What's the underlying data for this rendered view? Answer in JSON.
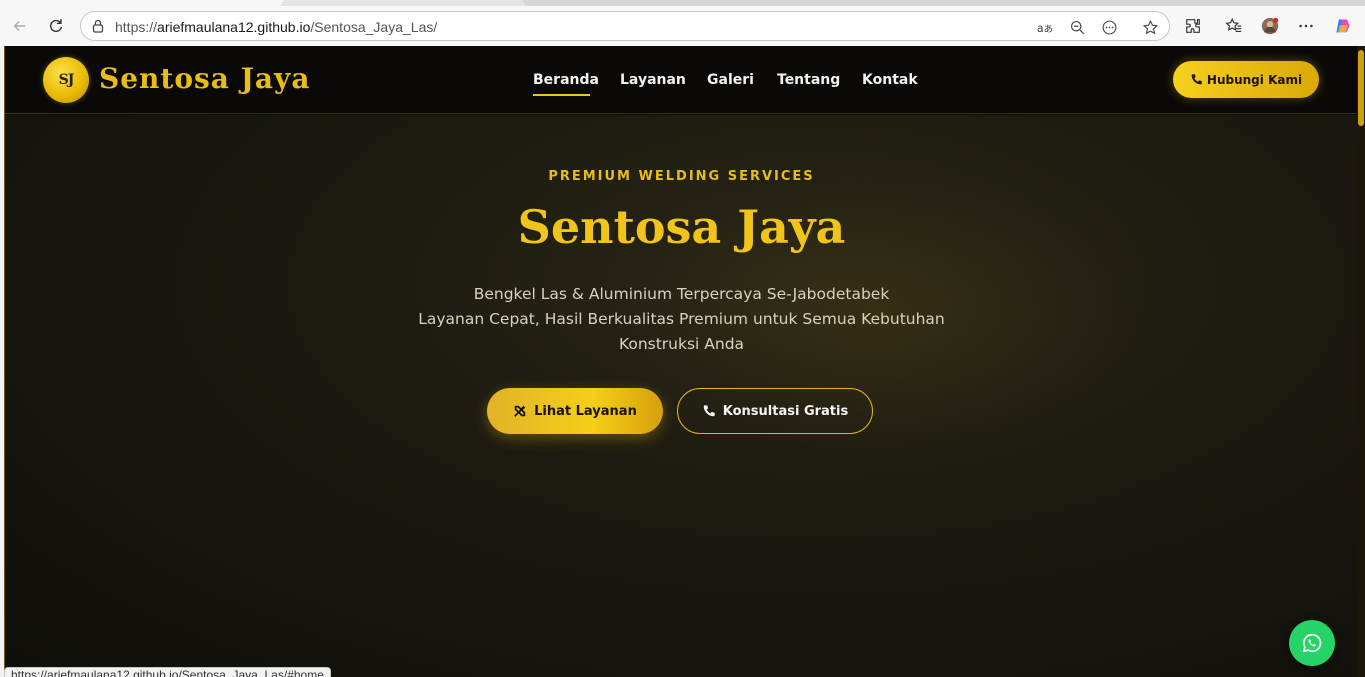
{
  "browser": {
    "url_prefix": "https://",
    "url_host": "ariefmaulana12.github.io",
    "url_path": "/Sentosa_Jaya_Las/",
    "status_url": "https://ariefmaulana12.github.io/Sentosa_Jaya_Las/#home",
    "icons": [
      "back-icon",
      "refresh-icon",
      "lock-icon",
      "read-aloud-icon",
      "zoom-out-icon",
      "more-page-icon",
      "star-icon",
      "extensions-icon",
      "favorites-icon",
      "profile-avatar",
      "more-icon",
      "copilot-icon"
    ]
  },
  "header": {
    "logo_badge": "SJ",
    "brand": "Sentosa Jaya",
    "nav": [
      "Beranda",
      "Layanan",
      "Galeri",
      "Tentang",
      "Kontak"
    ],
    "active_nav": "Beranda",
    "cta": "Hubungi Kami"
  },
  "hero": {
    "eyebrow": "PREMIUM WELDING SERVICES",
    "title": "Sentosa Jaya",
    "subtitle_line1": "Bengkel Las & Aluminium Terpercaya Se-Jabodetabek",
    "subtitle_line2": "Layanan Cepat, Hasil Berkualitas Premium untuk Semua Kebutuhan",
    "subtitle_line3": "Konstruksi Anda",
    "primary_button": "Lihat Layanan",
    "secondary_button": "Konsultasi Gratis"
  },
  "colors": {
    "accent": "#f0c419",
    "background": "#0c0b07",
    "whatsapp": "#25d366"
  }
}
